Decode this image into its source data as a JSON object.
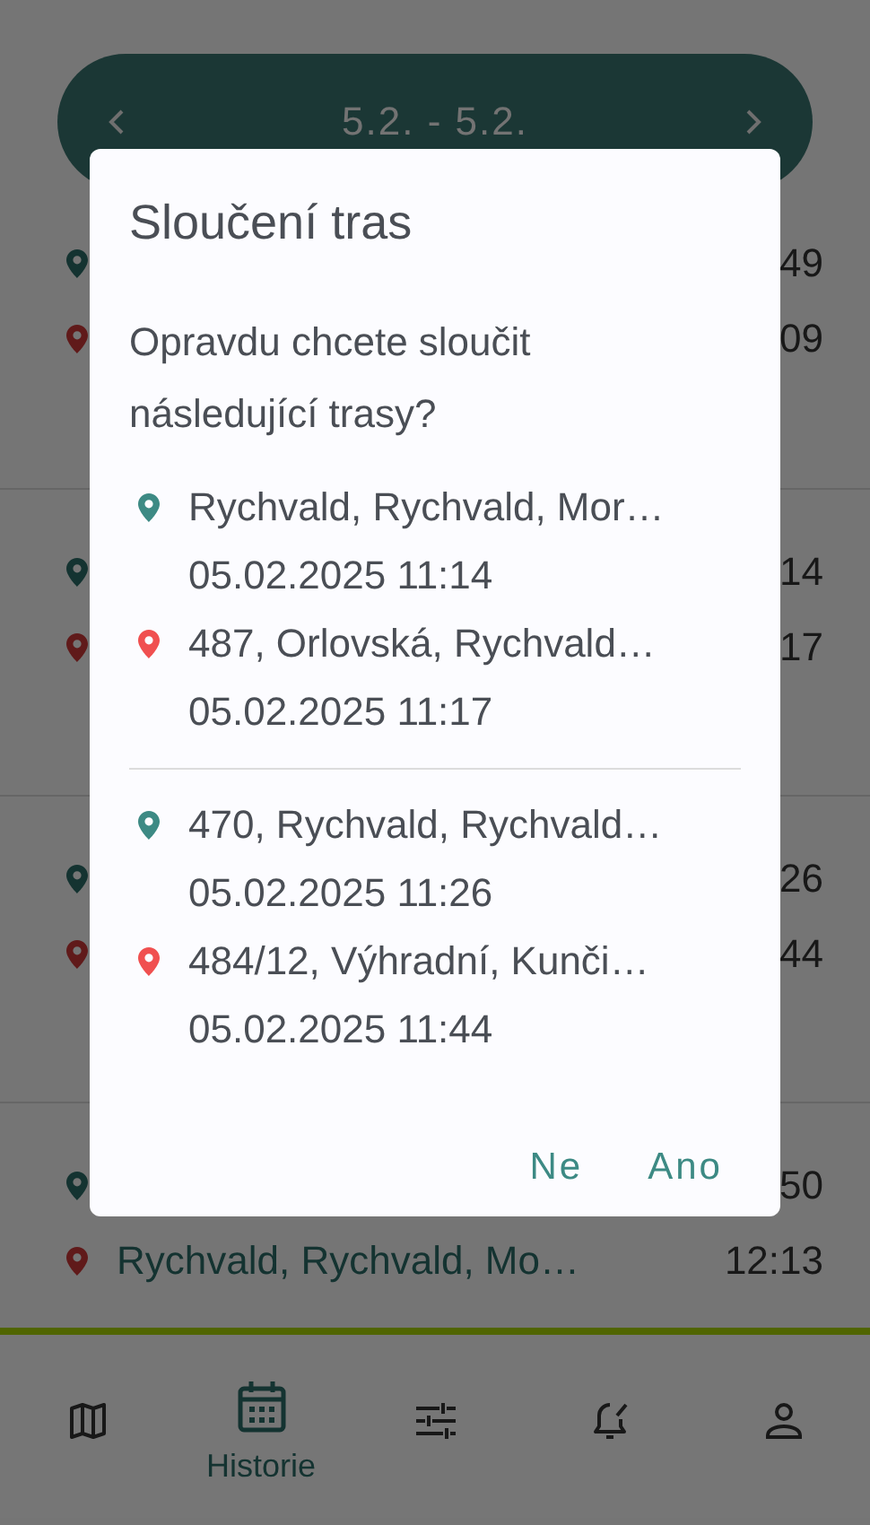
{
  "date_range": {
    "label": "5.2. - 5.2."
  },
  "routes": [
    {
      "points": [
        {
          "kind": "start",
          "time": "49"
        },
        {
          "kind": "end",
          "time": "09"
        }
      ]
    },
    {
      "points": [
        {
          "kind": "start",
          "time": "14"
        },
        {
          "kind": "end",
          "time": "17"
        }
      ]
    },
    {
      "points": [
        {
          "kind": "start",
          "time": "26"
        },
        {
          "kind": "end",
          "time": "44"
        }
      ]
    },
    {
      "points": [
        {
          "kind": "start",
          "time": "50"
        },
        {
          "kind": "end",
          "address": "Rychvald, Rychvald, Mo…",
          "time": "12:13"
        }
      ]
    }
  ],
  "bottom_nav": [
    {
      "kind": "map",
      "selected": false
    },
    {
      "kind": "calendar",
      "selected": true,
      "label": "Historie"
    },
    {
      "kind": "sliders",
      "selected": false
    },
    {
      "kind": "bell",
      "selected": false
    },
    {
      "kind": "person",
      "selected": false
    }
  ],
  "dialog": {
    "title": "Sloučení tras",
    "message": "Opravdu chcete sloučit následující trasy?",
    "routes": [
      {
        "points": [
          {
            "kind": "start",
            "address": "Rychvald, Rychvald, Mor…",
            "datetime": "05.02.2025 11:14"
          },
          {
            "kind": "end",
            "address": "487, Orlovská, Rychvald…",
            "datetime": "05.02.2025 11:17"
          }
        ]
      },
      {
        "points": [
          {
            "kind": "start",
            "address": "470, Rychvald, Rychvald…",
            "datetime": "05.02.2025 11:26"
          },
          {
            "kind": "end",
            "address": "484/12, Výhradní, Kunči…",
            "datetime": "05.02.2025 11:44"
          }
        ]
      }
    ],
    "buttons": [
      "Ne",
      "Ano"
    ]
  }
}
